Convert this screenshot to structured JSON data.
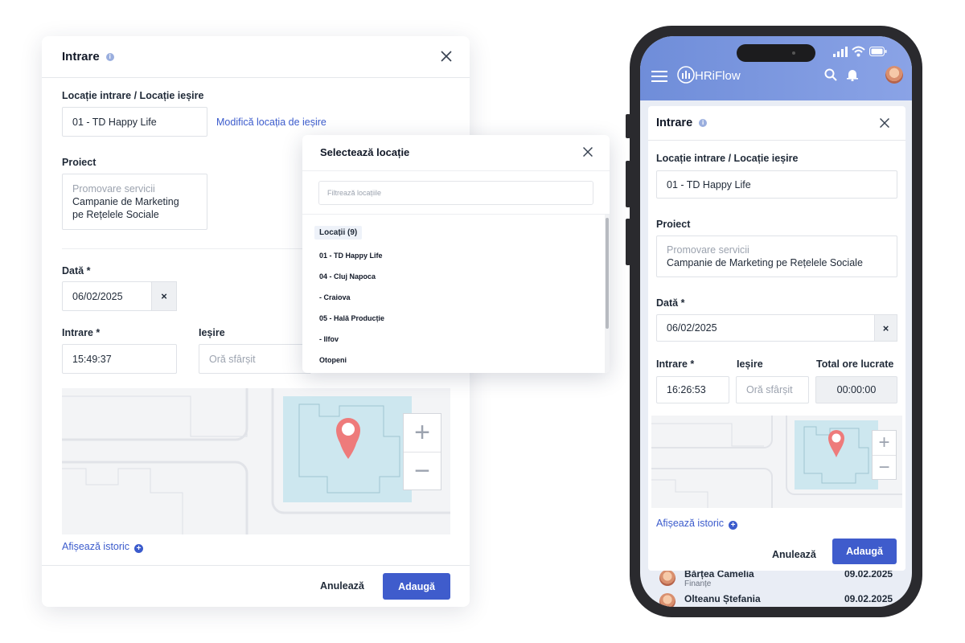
{
  "desktop": {
    "title": "Intrare",
    "info_icon": "i",
    "loc_label": "Locație intrare / Locație ieșire",
    "loc_value": "01 - TD Happy Life",
    "modify_link": "Modifică locația de ieșire",
    "project_label": "Proiect",
    "project_line1": "Promovare servicii",
    "project_line2": "Campanie de Marketing",
    "project_line3": "pe Rețelele Sociale",
    "date_label": "Dată *",
    "date_value": "06/02/2025",
    "clear_icon": "×",
    "entry_label": "Intrare *",
    "entry_value": "15:49:37",
    "exit_label": "Ieșire",
    "exit_placeholder": "Oră sfârșit",
    "zoom_in": "+",
    "zoom_out": "−",
    "history_link": "Afișează istoric",
    "history_icon": "+",
    "cancel": "Anulează",
    "add": "Adaugă"
  },
  "popup": {
    "title": "Selectează locație",
    "search_placeholder": "Filtrează locațiile",
    "group": "Locații (9)",
    "items": [
      "01 - TD Happy Life",
      "04 - Cluj Napoca",
      "- Craiova",
      "05 - Hală Producție",
      "- Ilfov",
      "Otopeni"
    ]
  },
  "phone": {
    "brand": "HRiFlow",
    "title": "Intrare",
    "info_icon": "i",
    "loc_label": "Locație intrare / Locație ieșire",
    "loc_value": "01 - TD Happy Life",
    "project_label": "Proiect",
    "project_line1": "Promovare servicii",
    "project_line2": "Campanie de Marketing pe Rețelele Sociale",
    "date_label": "Dată *",
    "date_value": "06/02/2025",
    "clear_icon": "×",
    "entry_label": "Intrare *",
    "entry_value": "16:26:53",
    "exit_label": "Ieșire",
    "exit_placeholder": "Oră sfârșit",
    "total_label": "Total ore lucrate",
    "total_value": "00:00:00",
    "zoom_in": "+",
    "zoom_out": "−",
    "history_link": "Afișează istoric",
    "history_icon": "+",
    "cancel": "Anulează",
    "add": "Adaugă",
    "bg_rows": [
      {
        "name": "Bărțea Camelia",
        "sub": "Finanțe",
        "date": "09.02.2025"
      },
      {
        "name": "Olteanu Ștefania",
        "sub": "",
        "date": "09.02.2025"
      }
    ]
  },
  "colors": {
    "accent": "#3f5ccc",
    "link": "#3b5bcc",
    "appbar": "#7a96de",
    "pin": "#ee7b7b",
    "map_building": "#cde7ef"
  }
}
